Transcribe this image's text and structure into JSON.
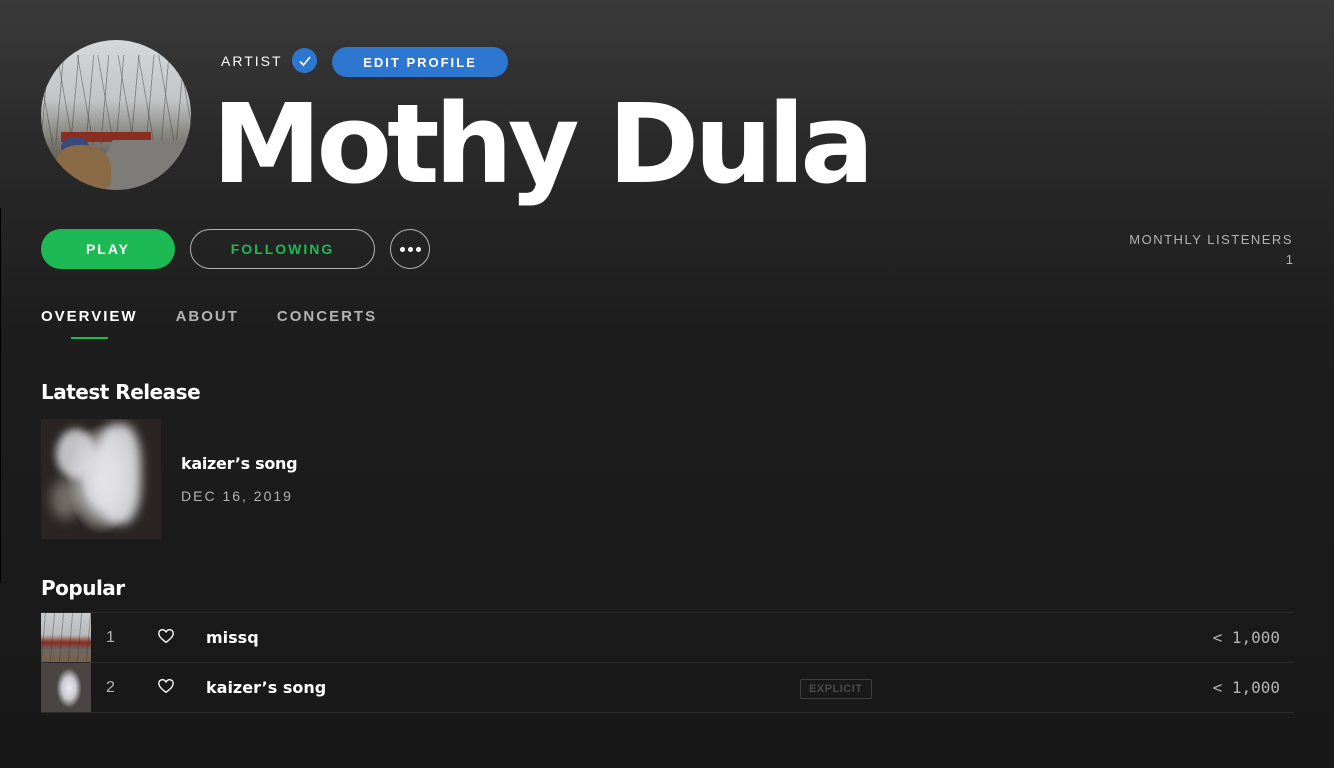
{
  "header": {
    "type_label": "ARTIST",
    "edit_profile_label": "EDIT PROFILE",
    "artist_name": "Mothy Dula",
    "verified_icon": "checkmark-icon",
    "accent_color": "#2e77d0"
  },
  "actions": {
    "play_label": "PLAY",
    "following_label": "FOLLOWING",
    "more_icon": "ellipsis-icon",
    "play_color": "#1db954"
  },
  "stats": {
    "monthly_listeners_label": "MONTHLY LISTENERS",
    "monthly_listeners_value": "1"
  },
  "tabs": [
    {
      "label": "OVERVIEW",
      "active": true
    },
    {
      "label": "ABOUT",
      "active": false
    },
    {
      "label": "CONCERTS",
      "active": false
    }
  ],
  "latest_release": {
    "section_title": "Latest Release",
    "title": "kaizer’s song",
    "date": "DEC 16, 2019"
  },
  "popular": {
    "section_title": "Popular",
    "tracks": [
      {
        "number": "1",
        "name": "missq",
        "explicit": false,
        "plays": "< 1,000"
      },
      {
        "number": "2",
        "name": "kaizer’s song",
        "explicit": true,
        "explicit_label": "EXPLICIT",
        "plays": "< 1,000"
      }
    ]
  }
}
